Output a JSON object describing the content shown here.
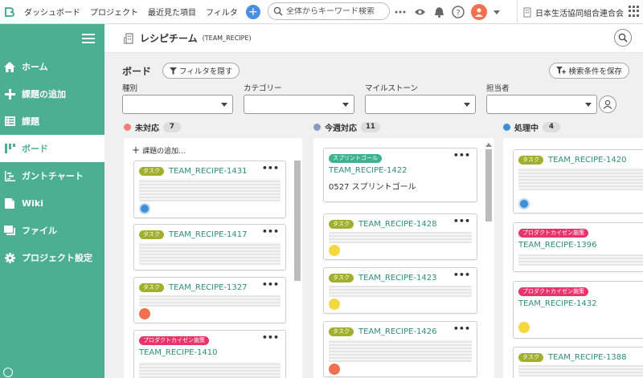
{
  "topbar": {
    "nav": [
      "ダッシュボード",
      "プロジェクト",
      "最近見た項目",
      "フィルタ"
    ],
    "search_placeholder": "全体からキーワード検索",
    "org": "日本生活協同組合連合会"
  },
  "sidebar": {
    "items": [
      {
        "label": "ホーム",
        "icon": "home-icon"
      },
      {
        "label": "課題の追加",
        "icon": "plus-icon"
      },
      {
        "label": "課題",
        "icon": "list-icon"
      },
      {
        "label": "ボード",
        "icon": "board-icon"
      },
      {
        "label": "ガントチャート",
        "icon": "gantt-icon"
      },
      {
        "label": "Wiki",
        "icon": "wiki-icon"
      },
      {
        "label": "ファイル",
        "icon": "folder-icon"
      },
      {
        "label": "プロジェクト設定",
        "icon": "gear-icon"
      }
    ],
    "active_index": 3
  },
  "project": {
    "name": "レシピチーム",
    "key": "(TEAM_RECIPE)"
  },
  "board": {
    "title": "ボード",
    "hide_filter_label": "フィルタを隠す",
    "save_search_label": "検索条件を保存",
    "filters": [
      {
        "label": "種別",
        "value": ""
      },
      {
        "label": "カテゴリー",
        "value": ""
      },
      {
        "label": "マイルストーン",
        "value": ""
      },
      {
        "label": "担当者",
        "value": ""
      }
    ]
  },
  "columns": [
    {
      "name": "未対応",
      "count": "7",
      "color": "#f08070",
      "add_label": "課題の追加...",
      "cards": [
        {
          "tag": "タスク",
          "tag_type": "task",
          "key": "TEAM_RECIPE-1431",
          "avatar": "blue"
        },
        {
          "tag": "タスク",
          "tag_type": "task",
          "key": "TEAM_RECIPE-1417",
          "avatar": ""
        },
        {
          "tag": "タスク",
          "tag_type": "task",
          "key": "TEAM_RECIPE-1327",
          "avatar": "orange"
        },
        {
          "tag": "プロダクトカイゼン施策",
          "tag_type": "kaizen",
          "key": "TEAM_RECIPE-1410",
          "avatar": ""
        }
      ]
    },
    {
      "name": "今週対応",
      "count": "11",
      "color": "#8a9ac6",
      "cards": [
        {
          "tag": "スプリントゴール",
          "tag_type": "sprint",
          "key": "TEAM_RECIPE-1422",
          "text": "0527 スプリントゴール",
          "avatar": ""
        },
        {
          "tag": "タスク",
          "tag_type": "task",
          "key": "TEAM_RECIPE-1428",
          "avatar": "yellow"
        },
        {
          "tag": "タスク",
          "tag_type": "task",
          "key": "TEAM_RECIPE-1423",
          "avatar": "yellow"
        },
        {
          "tag": "タスク",
          "tag_type": "task",
          "key": "TEAM_RECIPE-1426",
          "avatar": "orange"
        }
      ]
    },
    {
      "name": "処理中",
      "count": "4",
      "color": "#3d8fd8",
      "cards": [
        {
          "tag": "タスク",
          "tag_type": "task",
          "key": "TEAM_RECIPE-1420",
          "avatar": "blue"
        },
        {
          "tag": "プロダクトカイゼン施策",
          "tag_type": "kaizen",
          "key": "TEAM_RECIPE-1396",
          "avatar": ""
        },
        {
          "tag": "プロダクトカイゼン施策",
          "tag_type": "kaizen",
          "key": "TEAM_RECIPE-1432",
          "avatar": "yellow"
        },
        {
          "tag": "タスク",
          "tag_type": "task",
          "key": "TEAM_RECIPE-1388",
          "avatar": ""
        }
      ]
    }
  ],
  "colors": {
    "brand": "#4caf91",
    "link": "#2e8f75",
    "task": "#a1af2f",
    "sprint": "#3cb290",
    "kaizen": "#e8336b"
  }
}
